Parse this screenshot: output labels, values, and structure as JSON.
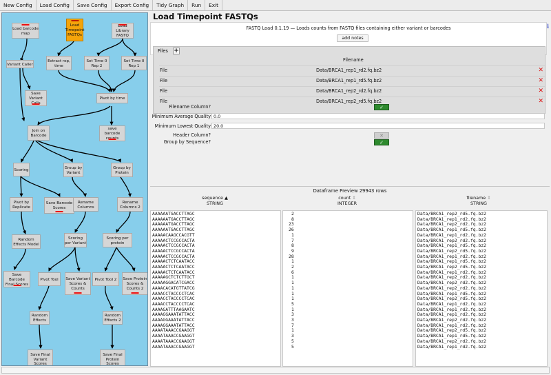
{
  "menu": [
    "New Config",
    "Load Config",
    "Save Config",
    "Export Config",
    "Tidy Graph",
    "Run",
    "Exit"
  ],
  "graph": {
    "nodes": [
      {
        "id": "load-barcode-map",
        "label": "Load barcode map"
      },
      {
        "id": "load-timepoint-fastqs",
        "label": "Load Timepoint FASTQs"
      },
      {
        "id": "load-library-fastq",
        "label": "Load Library FASTQ"
      },
      {
        "id": "variant-caller",
        "label": "Variant Caller"
      },
      {
        "id": "extract-rep-time",
        "label": "Extract rep, time"
      },
      {
        "id": "set-time-0-rep-2",
        "label": "Set Time 0 Rep 2"
      },
      {
        "id": "set-time-0-rep-1",
        "label": "Set Time 0 Rep 1"
      },
      {
        "id": "save-variant-calls",
        "label": "Save Variant Calls"
      },
      {
        "id": "pivot-by-time",
        "label": "Pivot by time"
      },
      {
        "id": "join-on-barcode",
        "label": "Join on Barcode"
      },
      {
        "id": "save-barcode-counts",
        "label": "save barcode counts"
      },
      {
        "id": "scoring",
        "label": "Scoring"
      },
      {
        "id": "group-by-variant",
        "label": "Group by Variant"
      },
      {
        "id": "group-by-protein",
        "label": "Group by Protein"
      },
      {
        "id": "pivot-by-replicate",
        "label": "Pivot by Replicate"
      },
      {
        "id": "save-barcode-scores",
        "label": "Save Barcode Scores"
      },
      {
        "id": "rename-columns",
        "label": "Rename Columns"
      },
      {
        "id": "rename-columns-2",
        "label": "Rename Columns 2"
      },
      {
        "id": "random-effects-model",
        "label": "Random Effects Model"
      },
      {
        "id": "scoring-per-variant",
        "label": "Scoring per Variant"
      },
      {
        "id": "scoring-per-protein",
        "label": "Scoring per protein"
      },
      {
        "id": "save-barcode-final-scores",
        "label": "Save Barcode Final Scores"
      },
      {
        "id": "pivot-tool",
        "label": "Pivot Tool"
      },
      {
        "id": "save-variant-scores-counts",
        "label": "Save Variant Scores & Counts"
      },
      {
        "id": "pivot-tool-2",
        "label": "Pivot Tool 2"
      },
      {
        "id": "save-protein-scores-counts-2",
        "label": "Save Protein Scores & Counts 2"
      },
      {
        "id": "random-effects",
        "label": "Random Effects"
      },
      {
        "id": "random-effects-2",
        "label": "Random Effects 2"
      },
      {
        "id": "save-final-variant-scores",
        "label": "Save Final Variant Scores"
      },
      {
        "id": "save-final-protein-scores",
        "label": "Save Final Protein Scores"
      }
    ]
  },
  "config": {
    "title": "Load Timepoint FASTQs",
    "description": "FASTQ Load 0.1.19 — Loads counts from FASTQ files containing either variant or barcodes",
    "add_notes": "add notes",
    "info_icon": "i",
    "files": {
      "label": "Files",
      "add_glyph": "+",
      "header": "Filename",
      "rows": [
        {
          "label": "File",
          "name": "Data/BRCA1_rep1_rd2.fq.bz2"
        },
        {
          "label": "File",
          "name": "Data/BRCA1_rep1_rd5.fq.bz2"
        },
        {
          "label": "File",
          "name": "Data/BRCA1_rep2_rd2.fq.bz2"
        },
        {
          "label": "File",
          "name": "Data/BRCA1_rep2_rd5.fq.bz2"
        }
      ],
      "delete_glyph": "✕"
    },
    "options": {
      "filename_column": {
        "label": "Filename Column?",
        "checked": true
      },
      "min_avg_quality": {
        "label": "Minimum Average Quality",
        "value": "0.0"
      },
      "min_lowest_quality": {
        "label": "Minimum Lowest Quality",
        "value": "20.0"
      },
      "header_column": {
        "label": "Header Column?",
        "checked": false
      },
      "group_by_sequence": {
        "label": "Group by Sequence?",
        "checked": true
      }
    },
    "check_glyph": "✓",
    "uncheck_glyph": "✕"
  },
  "preview": {
    "title": "Dataframe Preview 29943 rows",
    "columns": [
      {
        "name": "sequence",
        "type": "STRING",
        "sort": "▲"
      },
      {
        "name": "count",
        "type": "INTEGER",
        "sort": "⇕"
      },
      {
        "name": "filename",
        "type": "STRING",
        "sort": "⇕"
      }
    ],
    "rows": [
      [
        "AAAAAATGACCTTAGC",
        "2",
        "Data/BRCA1_rep2_rd5.fq.bz2"
      ],
      [
        "AAAAAATGACCTTAGC",
        "8",
        "Data/BRCA1_rep1_rd2.fq.bz2"
      ],
      [
        "AAAAAATGACCTTAGC",
        "23",
        "Data/BRCA1_rep2_rd2.fq.bz2"
      ],
      [
        "AAAAAATGACCTTAGC",
        "26",
        "Data/BRCA1_rep1_rd5.fq.bz2"
      ],
      [
        "AAAAACAAGCCACGTT",
        "1",
        "Data/BRCA1_rep1_rd2.fq.bz2"
      ],
      [
        "AAAAACTCCGCCACTA",
        "7",
        "Data/BRCA1_rep2_rd2.fq.bz2"
      ],
      [
        "AAAAACTCCGCCACTA",
        "8",
        "Data/BRCA1_rep1_rd5.fq.bz2"
      ],
      [
        "AAAAACTCCGCCACTA",
        "9",
        "Data/BRCA1_rep2_rd5.fq.bz2"
      ],
      [
        "AAAAACTCCGCCACTA",
        "28",
        "Data/BRCA1_rep1_rd2.fq.bz2"
      ],
      [
        "AAAAACTCTCAATACC",
        "1",
        "Data/BRCA1_rep1_rd5.fq.bz2"
      ],
      [
        "AAAAACTCTCAATACC",
        "2",
        "Data/BRCA1_rep2_rd5.fq.bz2"
      ],
      [
        "AAAAACTCTCAATACC",
        "6",
        "Data/BRCA1_rep1_rd2.fq.bz2"
      ],
      [
        "AAAAAGCTCTCTTGCT",
        "1",
        "Data/BRCA1_rep2_rd2.fq.bz2"
      ],
      [
        "AAAAAGGACATCGACC",
        "1",
        "Data/BRCA1_rep2_rd2.fq.bz2"
      ],
      [
        "AAAACACATGTTATCG",
        "1",
        "Data/BRCA1_rep2_rd2.fq.bz2"
      ],
      [
        "AAAACCTACCCCTCAC",
        "1",
        "Data/BRCA1_rep1_rd5.fq.bz2"
      ],
      [
        "AAAACCTACCCCTCAC",
        "1",
        "Data/BRCA1_rep2_rd5.fq.bz2"
      ],
      [
        "AAAACCTACCCCTCAC",
        "5",
        "Data/BRCA1_rep1_rd2.fq.bz2"
      ],
      [
        "AAAAGATTTAAGAATC",
        "1",
        "Data/BRCA1_rep1_rd2.fq.bz2"
      ],
      [
        "AAAAGGAAATATTACC",
        "3",
        "Data/BRCA1_rep1_rd2.fq.bz2"
      ],
      [
        "AAAAGGAAATATTACC",
        "3",
        "Data/BRCA1_rep2_rd2.fq.bz2"
      ],
      [
        "AAAAGGAAATATTACC",
        "7",
        "Data/BRCA1_rep1_rd2.fq.bz2"
      ],
      [
        "AAAATAAACCGAAGGT",
        "1",
        "Data/BRCA1_rep2_rd5.fq.bz2"
      ],
      [
        "AAAATAAACCGAAGGT",
        "3",
        "Data/BRCA1_rep1_rd5.fq.bz2"
      ],
      [
        "AAAATAAACCGAAGGT",
        "5",
        "Data/BRCA1_rep2_rd2.fq.bz2"
      ],
      [
        "AAAATAAACCGAAGGT",
        "5",
        "Data/BRCA1_rep1_rd2.fq.bz2"
      ]
    ]
  }
}
